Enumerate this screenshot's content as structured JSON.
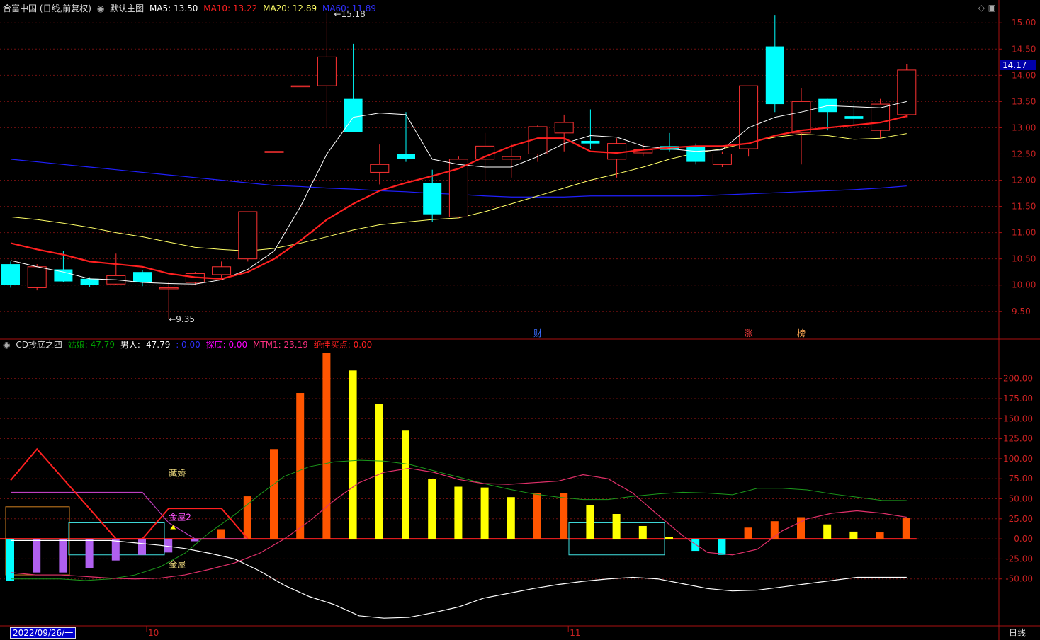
{
  "main_header": {
    "title": "合富中国 (日线,前复权)",
    "view": "默认主图",
    "ma5": "MA5: 13.50",
    "ma10": "MA10: 13.22",
    "ma20": "MA20: 12.89",
    "ma60": "MA60: 11.89"
  },
  "indicator_header": {
    "title": "CD抄底之四",
    "guniang": "姑娘: 47.79",
    "nanren": "男人: -47.79",
    "blank": ": 0.00",
    "tandi": "探底: 0.00",
    "mtm1": "MTM1: 23.19",
    "juejia": "绝佳买点: 0.00"
  },
  "current_price": "14.17",
  "hi_label": "15.18",
  "lo_label": "9.35",
  "date_label": "2022/09/26/一",
  "cycle_label": "日线",
  "x_ticks": [
    "10",
    "11"
  ],
  "event_marks": [
    "财",
    "涨",
    "榜"
  ],
  "annotations": [
    "藏娇",
    "金屋2",
    "金屋"
  ],
  "colors": {
    "up": "#ff3232",
    "down": "#00ffff",
    "ma5": "#ffffff",
    "ma10": "#ff2020",
    "ma20": "#ffff66",
    "ma60": "#2020ff",
    "grid": "#701010",
    "orange": "#ff5500",
    "yellow": "#ffff00",
    "purple": "#b060f0"
  },
  "chart_data": [
    {
      "type": "candlestick",
      "yticks": [
        "15.00",
        "14.50",
        "14.00",
        "13.50",
        "13.00",
        "12.50",
        "12.00",
        "11.50",
        "11.00",
        "10.50",
        "10.00",
        "9.50"
      ],
      "ylim": [
        9.2,
        15.3
      ],
      "candles": [
        {
          "o": 10.4,
          "c": 10.0,
          "h": 10.45,
          "l": 9.95
        },
        {
          "o": 9.95,
          "c": 10.35,
          "h": 10.4,
          "l": 9.9
        },
        {
          "o": 10.3,
          "c": 10.07,
          "h": 10.65,
          "l": 10.05
        },
        {
          "o": 10.12,
          "c": 10.0,
          "h": 10.15,
          "l": 9.97
        },
        {
          "o": 10.02,
          "c": 10.18,
          "h": 10.6,
          "l": 10.0
        },
        {
          "o": 10.25,
          "c": 10.05,
          "h": 10.28,
          "l": 9.98
        },
        {
          "o": 9.95,
          "c": 9.95,
          "h": 10.05,
          "l": 9.35
        },
        {
          "o": 10.05,
          "c": 10.22,
          "h": 10.25,
          "l": 10.0
        },
        {
          "o": 10.2,
          "c": 10.35,
          "h": 10.45,
          "l": 10.1
        },
        {
          "o": 10.5,
          "c": 11.4,
          "h": 11.4,
          "l": 10.45
        },
        {
          "o": 12.55,
          "c": 12.55,
          "h": 12.55,
          "l": 12.55
        },
        {
          "o": 13.8,
          "c": 13.8,
          "h": 13.8,
          "l": 13.8
        },
        {
          "o": 13.8,
          "c": 14.35,
          "h": 15.18,
          "l": 13.02
        },
        {
          "o": 13.55,
          "c": 12.92,
          "h": 14.6,
          "l": 12.92
        },
        {
          "o": 12.15,
          "c": 12.3,
          "h": 12.68,
          "l": 11.92
        },
        {
          "o": 12.5,
          "c": 12.4,
          "h": 13.3,
          "l": 12.35
        },
        {
          "o": 11.95,
          "c": 11.35,
          "h": 12.2,
          "l": 11.2
        },
        {
          "o": 11.3,
          "c": 12.4,
          "h": 12.45,
          "l": 11.28
        },
        {
          "o": 12.4,
          "c": 12.65,
          "h": 12.9,
          "l": 12.0
        },
        {
          "o": 12.4,
          "c": 12.45,
          "h": 12.7,
          "l": 12.05
        },
        {
          "o": 12.5,
          "c": 13.02,
          "h": 13.05,
          "l": 12.35
        },
        {
          "o": 12.9,
          "c": 13.1,
          "h": 13.25,
          "l": 12.55
        },
        {
          "o": 12.75,
          "c": 12.7,
          "h": 13.35,
          "l": 12.6
        },
        {
          "o": 12.4,
          "c": 12.7,
          "h": 12.8,
          "l": 12.05
        },
        {
          "o": 12.52,
          "c": 12.58,
          "h": 12.7,
          "l": 12.45
        },
        {
          "o": 12.65,
          "c": 12.58,
          "h": 12.9,
          "l": 12.55
        },
        {
          "o": 12.65,
          "c": 12.35,
          "h": 12.7,
          "l": 12.3
        },
        {
          "o": 12.3,
          "c": 12.5,
          "h": 12.55,
          "l": 12.25
        },
        {
          "o": 12.6,
          "c": 13.8,
          "h": 13.8,
          "l": 12.45
        },
        {
          "o": 14.55,
          "c": 13.45,
          "h": 15.15,
          "l": 13.3
        },
        {
          "o": 12.9,
          "c": 13.5,
          "h": 13.75,
          "l": 12.3
        },
        {
          "o": 13.55,
          "c": 13.3,
          "h": 13.55,
          "l": 12.95
        },
        {
          "o": 13.22,
          "c": 13.17,
          "h": 13.45,
          "l": 13.05
        },
        {
          "o": 12.95,
          "c": 13.45,
          "h": 13.55,
          "l": 12.8
        },
        {
          "o": 13.25,
          "c": 14.1,
          "h": 14.22,
          "l": 13.2
        }
      ],
      "ma5": [
        10.47,
        10.35,
        10.25,
        10.12,
        10.1,
        10.05,
        10.03,
        10.02,
        10.1,
        10.3,
        10.65,
        11.5,
        12.5,
        13.2,
        13.28,
        13.25,
        12.4,
        12.3,
        12.25,
        12.25,
        12.45,
        12.7,
        12.85,
        12.82,
        12.65,
        12.6,
        12.55,
        12.58,
        13.0,
        13.2,
        13.3,
        13.42,
        13.4,
        13.38,
        13.5
      ],
      "ma10": [
        10.8,
        10.68,
        10.58,
        10.45,
        10.4,
        10.35,
        10.22,
        10.15,
        10.12,
        10.25,
        10.5,
        10.85,
        11.25,
        11.55,
        11.8,
        11.95,
        12.08,
        12.22,
        12.45,
        12.65,
        12.8,
        12.8,
        12.55,
        12.52,
        12.58,
        12.62,
        12.65,
        12.65,
        12.7,
        12.85,
        12.95,
        13.0,
        13.05,
        13.1,
        13.22
      ],
      "ma20": [
        11.3,
        11.25,
        11.18,
        11.1,
        11.0,
        10.92,
        10.82,
        10.72,
        10.68,
        10.65,
        10.7,
        10.8,
        10.92,
        11.05,
        11.15,
        11.2,
        11.25,
        11.28,
        11.4,
        11.55,
        11.7,
        11.85,
        12.0,
        12.12,
        12.25,
        12.4,
        12.52,
        12.6,
        12.72,
        12.82,
        12.88,
        12.85,
        12.78,
        12.8,
        12.89
      ],
      "ma60": [
        12.4,
        12.35,
        12.3,
        12.25,
        12.2,
        12.15,
        12.1,
        12.05,
        12.0,
        11.95,
        11.9,
        11.88,
        11.85,
        11.83,
        11.8,
        11.78,
        11.75,
        11.73,
        11.7,
        11.68,
        11.68,
        11.68,
        11.7,
        11.7,
        11.7,
        11.7,
        11.7,
        11.72,
        11.74,
        11.76,
        11.78,
        11.8,
        11.82,
        11.85,
        11.89
      ]
    },
    {
      "type": "bar",
      "yticks": [
        "200.00",
        "175.00",
        "150.00",
        "125.00",
        "100.00",
        "75.00",
        "50.00",
        "25.00",
        "0.00",
        "-25.00",
        "-50.00"
      ],
      "ylim": [
        -105,
        235
      ],
      "bars": [
        {
          "v": -52,
          "c": "down"
        },
        {
          "v": -42,
          "c": "purple"
        },
        {
          "v": -42,
          "c": "purple"
        },
        {
          "v": -37,
          "c": "purple"
        },
        {
          "v": -27,
          "c": "purple"
        },
        {
          "v": -20,
          "c": "purple"
        },
        {
          "v": -17,
          "c": "purple"
        },
        {
          "v": -3,
          "c": "purple"
        },
        {
          "v": 12,
          "c": "orange"
        },
        {
          "v": 53,
          "c": "orange"
        },
        {
          "v": 112,
          "c": "orange"
        },
        {
          "v": 182,
          "c": "orange"
        },
        {
          "v": 232,
          "c": "orange"
        },
        {
          "v": 210,
          "c": "yellow"
        },
        {
          "v": 168,
          "c": "yellow"
        },
        {
          "v": 135,
          "c": "yellow"
        },
        {
          "v": 75,
          "c": "yellow"
        },
        {
          "v": 65,
          "c": "yellow"
        },
        {
          "v": 64,
          "c": "yellow"
        },
        {
          "v": 52,
          "c": "yellow"
        },
        {
          "v": 57,
          "c": "orange"
        },
        {
          "v": 57,
          "c": "orange"
        },
        {
          "v": 42,
          "c": "yellow"
        },
        {
          "v": 31,
          "c": "yellow"
        },
        {
          "v": 16,
          "c": "yellow"
        },
        {
          "v": 2,
          "c": "yellow"
        },
        {
          "v": -15,
          "c": "down"
        },
        {
          "v": -20,
          "c": "down"
        },
        {
          "v": 14,
          "c": "orange"
        },
        {
          "v": 22,
          "c": "orange"
        },
        {
          "v": 27,
          "c": "orange"
        },
        {
          "v": 18,
          "c": "yellow"
        },
        {
          "v": 9,
          "c": "yellow"
        },
        {
          "v": 8,
          "c": "orange"
        },
        {
          "v": 26,
          "c": "orange"
        }
      ],
      "white_line": [
        -2,
        -2,
        -2,
        -2,
        -2,
        -5,
        -8,
        -12,
        -18,
        -25,
        -40,
        -58,
        -72,
        -82,
        -96,
        -99,
        -98,
        -92,
        -85,
        -74,
        -68,
        -62,
        -57,
        -53,
        -50,
        -48,
        -50,
        -56,
        -62,
        -65,
        -64,
        -60,
        -56,
        -52,
        -48,
        -48,
        -48
      ],
      "green_line": [
        -50,
        -50,
        -50,
        -52,
        -50,
        -45,
        -35,
        -18,
        8,
        30,
        55,
        78,
        90,
        96,
        98,
        97,
        93,
        85,
        77,
        69,
        62,
        56,
        52,
        49,
        49,
        53,
        56,
        58,
        57,
        55,
        63,
        63,
        61,
        56,
        52,
        48,
        47.79
      ],
      "pink_line": [
        -42,
        -45,
        -45,
        -47,
        -49,
        -50,
        -49,
        -45,
        -38,
        -30,
        -18,
        0,
        22,
        48,
        70,
        83,
        88,
        83,
        74,
        69,
        68,
        70,
        72,
        80,
        75,
        57,
        30,
        4,
        -17,
        -20,
        -13,
        10,
        25,
        32,
        35,
        32,
        27
      ],
      "red_zigzag": [
        {
          "i": 0,
          "v": 73
        },
        {
          "i": 1,
          "v": 112
        },
        {
          "i": 4,
          "v": 0
        },
        {
          "i": 5,
          "v": 0
        },
        {
          "i": 6,
          "v": 38
        },
        {
          "i": 8,
          "v": 38
        },
        {
          "i": 9,
          "v": 0
        }
      ],
      "magenta_line": [
        {
          "i": 0,
          "v": 58
        },
        {
          "i": 5,
          "v": 58
        },
        {
          "i": 6,
          "v": 20
        },
        {
          "i": 7,
          "v": 0
        },
        {
          "i": 9,
          "v": 0
        }
      ]
    }
  ]
}
